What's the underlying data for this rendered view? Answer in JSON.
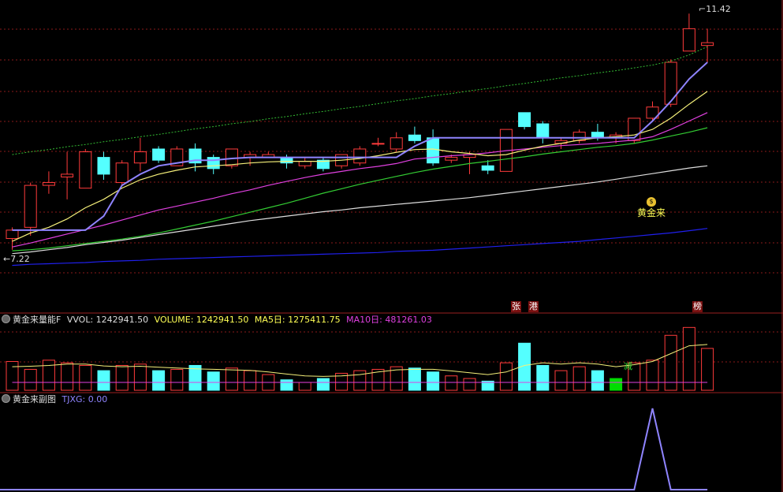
{
  "colors": {
    "up": "#ff3b3b",
    "down": "#54ffff",
    "ma_short": "#8f84ff",
    "ma_yellow": "#f5f07a",
    "ma_magenta": "#e040e0",
    "ma_green": "#33cc33",
    "ma_white": "#dddddd",
    "ma_blue": "#2020ee",
    "dotted_green": "#33bb33",
    "grid": "#8a1a1a",
    "text_yellow": "#ffff55",
    "text_magenta": "#e040e0",
    "text_blue": "#8f84ff"
  },
  "main": {
    "high_label": "11.42",
    "low_label": "7.22",
    "signal_icon": "money-bag-icon",
    "signal_text": "黄金来",
    "markers": [
      "张",
      "港",
      "榜"
    ]
  },
  "volume_panel": {
    "name": "黄金来量能F",
    "vol_label": "VVOL: 1242941.50",
    "volume_label": "VOLUME: 1242941.50",
    "ma5_label": "MA5日: 1275411.75",
    "ma10_label": "MA10日: 481261.03",
    "mark": "减"
  },
  "sub_panel": {
    "name": "黄金来副图",
    "tjxg_label": "TJXG: 0.00"
  },
  "chart_data": {
    "type": "candlestick",
    "price_range": [
      7.22,
      11.42
    ],
    "candles": [
      {
        "o": 7.4,
        "c": 7.55,
        "h": 7.6,
        "l": 7.2
      },
      {
        "o": 7.6,
        "c": 8.35,
        "h": 8.4,
        "l": 7.45
      },
      {
        "o": 8.35,
        "c": 8.4,
        "h": 8.6,
        "l": 8.2
      },
      {
        "o": 8.5,
        "c": 8.55,
        "h": 8.95,
        "l": 8.1
      },
      {
        "o": 8.3,
        "c": 8.95,
        "h": 9.0,
        "l": 8.3
      },
      {
        "o": 8.85,
        "c": 8.55,
        "h": 8.95,
        "l": 8.45
      },
      {
        "o": 8.4,
        "c": 8.75,
        "h": 8.8,
        "l": 8.35
      },
      {
        "o": 8.75,
        "c": 8.95,
        "h": 9.2,
        "l": 8.6
      },
      {
        "o": 9.0,
        "c": 8.8,
        "h": 9.05,
        "l": 8.75
      },
      {
        "o": 8.7,
        "c": 9.0,
        "h": 9.05,
        "l": 8.7
      },
      {
        "o": 9.0,
        "c": 8.75,
        "h": 9.1,
        "l": 8.6
      },
      {
        "o": 8.85,
        "c": 8.65,
        "h": 8.9,
        "l": 8.55
      },
      {
        "o": 8.7,
        "c": 9.0,
        "h": 9.0,
        "l": 8.65
      },
      {
        "o": 8.85,
        "c": 8.9,
        "h": 8.95,
        "l": 8.7
      },
      {
        "o": 8.85,
        "c": 8.9,
        "h": 8.95,
        "l": 8.85
      },
      {
        "o": 8.85,
        "c": 8.75,
        "h": 8.9,
        "l": 8.65
      },
      {
        "o": 8.7,
        "c": 8.78,
        "h": 8.85,
        "l": 8.65
      },
      {
        "o": 8.8,
        "c": 8.65,
        "h": 8.85,
        "l": 8.6
      },
      {
        "o": 8.7,
        "c": 8.9,
        "h": 8.9,
        "l": 8.65
      },
      {
        "o": 8.75,
        "c": 9.0,
        "h": 9.05,
        "l": 8.7
      },
      {
        "o": 9.1,
        "c": 9.1,
        "h": 9.2,
        "l": 9.05
      },
      {
        "o": 9.0,
        "c": 9.2,
        "h": 9.3,
        "l": 8.95
      },
      {
        "o": 9.25,
        "c": 9.15,
        "h": 9.4,
        "l": 9.1
      },
      {
        "o": 9.2,
        "c": 8.75,
        "h": 9.35,
        "l": 8.7
      },
      {
        "o": 8.8,
        "c": 8.85,
        "h": 8.9,
        "l": 8.75
      },
      {
        "o": 8.85,
        "c": 8.9,
        "h": 8.95,
        "l": 8.55
      },
      {
        "o": 8.7,
        "c": 8.62,
        "h": 8.8,
        "l": 8.55
      },
      {
        "o": 8.6,
        "c": 9.35,
        "h": 9.35,
        "l": 8.6
      },
      {
        "o": 9.65,
        "c": 9.4,
        "h": 9.65,
        "l": 9.35
      },
      {
        "o": 9.45,
        "c": 9.2,
        "h": 9.5,
        "l": 9.1
      },
      {
        "o": 9.1,
        "c": 9.15,
        "h": 9.2,
        "l": 9.0
      },
      {
        "o": 9.15,
        "c": 9.3,
        "h": 9.35,
        "l": 9.1
      },
      {
        "o": 9.3,
        "c": 9.2,
        "h": 9.45,
        "l": 9.15
      },
      {
        "o": 9.2,
        "c": 9.25,
        "h": 9.3,
        "l": 9.1
      },
      {
        "o": 9.15,
        "c": 9.55,
        "h": 9.55,
        "l": 9.1
      },
      {
        "o": 9.55,
        "c": 9.75,
        "h": 9.85,
        "l": 9.5
      },
      {
        "o": 9.8,
        "c": 10.55,
        "h": 10.6,
        "l": 9.75
      },
      {
        "o": 10.75,
        "c": 11.15,
        "h": 11.42,
        "l": 10.75
      },
      {
        "o": 10.85,
        "c": 10.9,
        "h": 11.15,
        "l": 10.55
      }
    ],
    "ma_short": [
      7.55,
      7.55,
      7.55,
      7.55,
      7.55,
      7.8,
      8.35,
      8.55,
      8.7,
      8.75,
      8.8,
      8.8,
      8.83,
      8.85,
      8.85,
      8.85,
      8.85,
      8.85,
      8.85,
      8.85,
      8.85,
      8.85,
      9.05,
      9.2,
      9.2,
      9.2,
      9.2,
      9.2,
      9.2,
      9.2,
      9.2,
      9.2,
      9.2,
      9.2,
      9.2,
      9.5,
      9.85,
      10.25,
      10.55
    ],
    "ma_yellow": [
      7.35,
      7.5,
      7.6,
      7.75,
      7.95,
      8.1,
      8.3,
      8.45,
      8.55,
      8.62,
      8.68,
      8.7,
      8.72,
      8.75,
      8.77,
      8.78,
      8.78,
      8.78,
      8.8,
      8.83,
      8.88,
      8.94,
      8.99,
      9.0,
      8.95,
      8.92,
      8.88,
      8.9,
      8.98,
      9.05,
      9.1,
      9.16,
      9.2,
      9.22,
      9.25,
      9.35,
      9.55,
      9.8,
      10.03
    ],
    "ma_magenta": [
      7.25,
      7.32,
      7.4,
      7.48,
      7.56,
      7.64,
      7.73,
      7.82,
      7.91,
      7.98,
      8.05,
      8.12,
      8.2,
      8.27,
      8.35,
      8.42,
      8.49,
      8.55,
      8.6,
      8.65,
      8.69,
      8.74,
      8.82,
      8.85,
      8.88,
      8.9,
      8.93,
      8.97,
      9.0,
      9.03,
      9.06,
      9.08,
      9.1,
      9.13,
      9.16,
      9.22,
      9.35,
      9.5,
      9.65
    ],
    "ma_green": [
      7.18,
      7.2,
      7.23,
      7.27,
      7.31,
      7.35,
      7.39,
      7.44,
      7.5,
      7.57,
      7.64,
      7.71,
      7.79,
      7.87,
      7.95,
      8.03,
      8.12,
      8.21,
      8.29,
      8.37,
      8.44,
      8.51,
      8.58,
      8.64,
      8.69,
      8.74,
      8.78,
      8.82,
      8.86,
      8.91,
      8.95,
      8.99,
      9.03,
      9.06,
      9.1,
      9.16,
      9.23,
      9.3,
      9.38
    ],
    "ma_white": [
      7.13,
      7.16,
      7.2,
      7.24,
      7.29,
      7.33,
      7.37,
      7.42,
      7.47,
      7.52,
      7.57,
      7.62,
      7.67,
      7.72,
      7.76,
      7.8,
      7.84,
      7.88,
      7.91,
      7.95,
      7.98,
      8.01,
      8.04,
      8.07,
      8.1,
      8.13,
      8.17,
      8.21,
      8.25,
      8.29,
      8.33,
      8.37,
      8.41,
      8.46,
      8.51,
      8.56,
      8.61,
      8.66,
      8.7
    ],
    "ma_blue": [
      6.92,
      6.94,
      6.95,
      6.96,
      6.97,
      6.99,
      7.0,
      7.01,
      7.03,
      7.04,
      7.05,
      7.06,
      7.07,
      7.08,
      7.09,
      7.1,
      7.11,
      7.12,
      7.13,
      7.14,
      7.15,
      7.17,
      7.18,
      7.19,
      7.21,
      7.23,
      7.25,
      7.27,
      7.29,
      7.31,
      7.33,
      7.35,
      7.38,
      7.41,
      7.44,
      7.47,
      7.5,
      7.54,
      7.58
    ],
    "ma_dotted": [
      8.9,
      8.95,
      8.99,
      9.04,
      9.08,
      9.13,
      9.17,
      9.22,
      9.26,
      9.31,
      9.36,
      9.4,
      9.45,
      9.49,
      9.54,
      9.58,
      9.63,
      9.67,
      9.72,
      9.76,
      9.81,
      9.86,
      9.9,
      9.95,
      9.99,
      10.04,
      10.08,
      10.13,
      10.17,
      10.22,
      10.27,
      10.31,
      10.36,
      10.4,
      10.45,
      10.5,
      10.57,
      10.68,
      10.83
    ],
    "volume": [
      1.1,
      0.8,
      1.15,
      1.05,
      0.95,
      0.75,
      0.95,
      1.0,
      0.75,
      0.8,
      0.95,
      0.7,
      0.85,
      0.75,
      0.6,
      0.4,
      0.3,
      0.45,
      0.65,
      0.75,
      0.8,
      0.9,
      0.85,
      0.7,
      0.55,
      0.45,
      0.35,
      1.05,
      1.8,
      0.95,
      0.75,
      0.9,
      0.75,
      0.45,
      1.05,
      1.15,
      2.1,
      2.4,
      1.6
    ],
    "vol_ma": [
      0.9,
      0.92,
      0.95,
      1.0,
      1.0,
      0.93,
      0.9,
      0.92,
      0.88,
      0.85,
      0.82,
      0.8,
      0.78,
      0.76,
      0.7,
      0.62,
      0.55,
      0.53,
      0.55,
      0.6,
      0.7,
      0.78,
      0.8,
      0.8,
      0.74,
      0.67,
      0.6,
      0.7,
      0.95,
      1.05,
      1.0,
      1.05,
      1.0,
      0.9,
      0.98,
      1.1,
      1.4,
      1.7,
      1.75
    ],
    "vol_ma2": [
      0.3,
      0.3,
      0.3,
      0.3,
      0.3,
      0.3,
      0.3,
      0.3,
      0.3,
      0.3,
      0.3,
      0.3,
      0.3,
      0.3,
      0.3,
      0.3,
      0.3,
      0.3,
      0.3,
      0.3,
      0.3,
      0.3,
      0.3,
      0.3,
      0.3,
      0.3,
      0.3,
      0.3,
      0.3,
      0.3,
      0.3,
      0.3,
      0.3,
      0.3,
      0.3,
      0.3,
      0.3,
      0.3,
      0.3
    ],
    "tjxg": [
      0,
      0,
      0,
      0,
      0,
      0,
      0,
      0,
      0,
      0,
      0,
      0,
      0,
      0,
      0,
      0,
      0,
      0,
      0,
      0,
      0,
      0,
      0,
      0,
      0,
      0,
      0,
      0,
      0,
      0,
      0,
      0,
      0,
      0,
      0,
      1,
      0,
      0,
      0
    ]
  }
}
